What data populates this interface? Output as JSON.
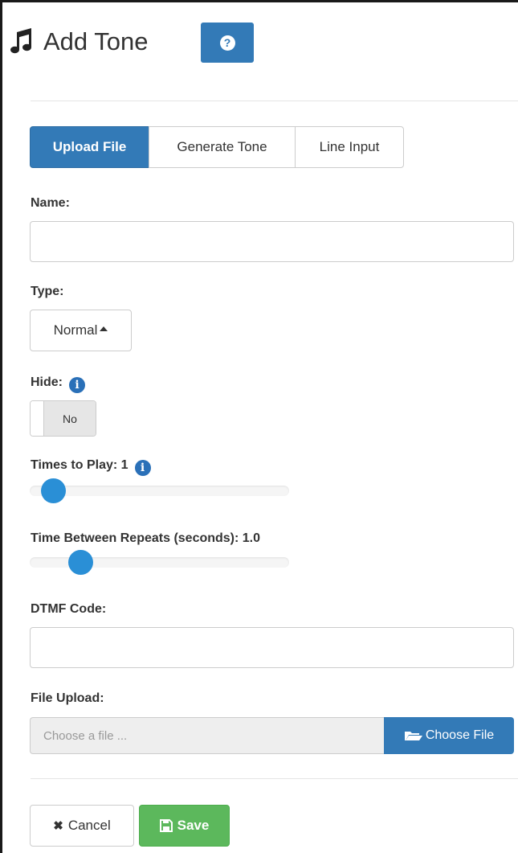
{
  "header": {
    "title": "Add Tone",
    "icon": "music-note-icon",
    "help_icon": "question-circle-icon",
    "help_symbol": "?"
  },
  "tabs": [
    {
      "label": "Upload File",
      "active": true
    },
    {
      "label": "Generate Tone",
      "active": false
    },
    {
      "label": "Line Input",
      "active": false
    }
  ],
  "form": {
    "name": {
      "label": "Name:",
      "value": ""
    },
    "type": {
      "label": "Type:",
      "value": "Normal"
    },
    "hide": {
      "label": "Hide:",
      "value": "No",
      "info_icon": "info-circle-icon",
      "info_symbol": "i"
    },
    "times_to_play": {
      "label": "Times to Play: 1",
      "value": 1,
      "info_icon": "info-circle-icon",
      "info_symbol": "i"
    },
    "time_between_repeats": {
      "label": "Time Between Repeats (seconds): 1.0",
      "value": 1.0
    },
    "dtmf_code": {
      "label": "DTMF Code:",
      "value": ""
    },
    "file_upload": {
      "label": "File Upload:",
      "placeholder": "Choose a file ...",
      "button_label": "Choose File",
      "button_icon": "folder-open-icon"
    }
  },
  "actions": {
    "cancel_label": "Cancel",
    "cancel_symbol": "✖",
    "cancel_icon": "close-icon",
    "save_label": "Save",
    "save_icon": "floppy-disk-icon"
  },
  "colors": {
    "primary": "#337ab7",
    "success": "#5cb85c",
    "slider": "#2a8fd6"
  }
}
